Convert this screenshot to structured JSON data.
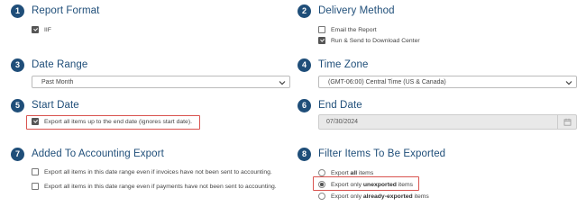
{
  "sections": {
    "report_format": {
      "num": "1",
      "title": "Report Format",
      "option": "IIF"
    },
    "delivery_method": {
      "num": "2",
      "title": "Delivery Method",
      "opt1": "Email the Report",
      "opt2": "Run & Send to Download Center"
    },
    "date_range": {
      "num": "3",
      "title": "Date Range",
      "value": "Past Month"
    },
    "time_zone": {
      "num": "4",
      "title": "Time Zone",
      "value": "(GMT-06:00) Central Time (US & Canada)"
    },
    "start_date": {
      "num": "5",
      "title": "Start Date",
      "option": "Export all items up to the end date (ignores start date)."
    },
    "end_date": {
      "num": "6",
      "title": "End Date",
      "value": "07/30/2024"
    },
    "accounting": {
      "num": "7",
      "title": "Added To Accounting Export",
      "opt1": "Export all items in this date range even if invoices have not been sent to accounting.",
      "opt2": "Export all items in this date range even if payments have not been sent to accounting."
    },
    "filter": {
      "num": "8",
      "title": "Filter Items To Be Exported",
      "r1_pre": "Export ",
      "r1_bold": "all",
      "r1_post": " items",
      "r2_pre": "Export only ",
      "r2_bold": "unexported",
      "r2_post": " items",
      "r3_pre": "Export only ",
      "r3_bold": "already-exported",
      "r3_post": " items"
    }
  },
  "colors": {
    "accent": "#1f4e79",
    "highlight": "#d9534f"
  }
}
